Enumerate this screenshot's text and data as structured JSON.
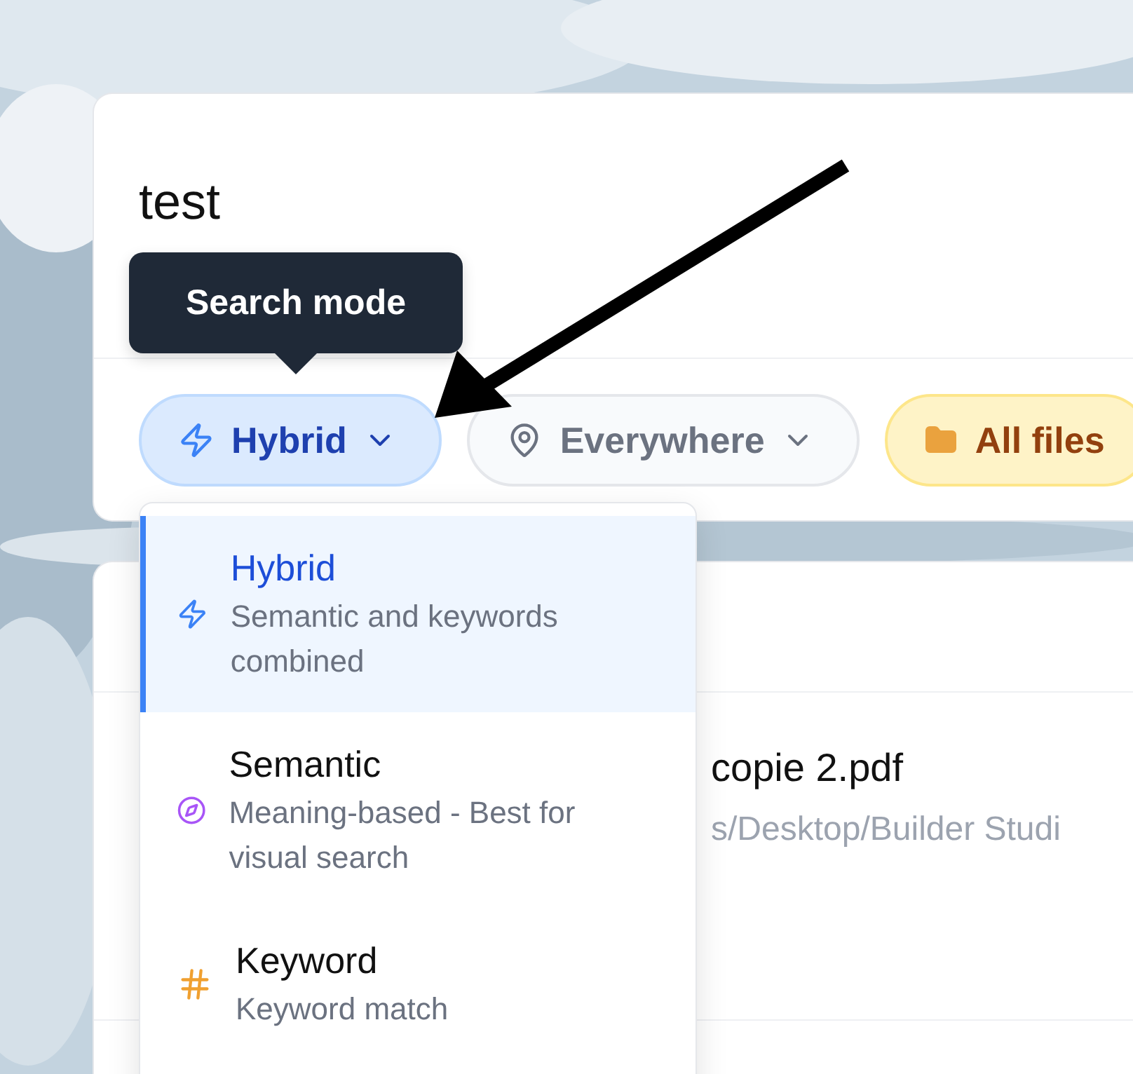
{
  "search": {
    "value": "test"
  },
  "tooltip": {
    "text": "Search mode"
  },
  "filters": [
    {
      "kind": "mode",
      "label": "Hybrid",
      "expanded": true
    },
    {
      "kind": "location",
      "label": "Everywhere",
      "expanded": false
    },
    {
      "kind": "type",
      "label": "All files",
      "expanded": false
    }
  ],
  "dropdown": {
    "options": [
      {
        "kind": "hybrid",
        "title": "Hybrid",
        "description": "Semantic and keywords combined",
        "selected": true
      },
      {
        "kind": "semantic",
        "title": "Semantic",
        "description": "Meaning-based - Best for visual search",
        "selected": false
      },
      {
        "kind": "keyword",
        "title": "Keyword",
        "description": "Keyword match",
        "selected": false
      }
    ]
  },
  "results": [
    {
      "name": "copie 2.pdf",
      "path": "s/Desktop/Builder Studi"
    }
  ]
}
